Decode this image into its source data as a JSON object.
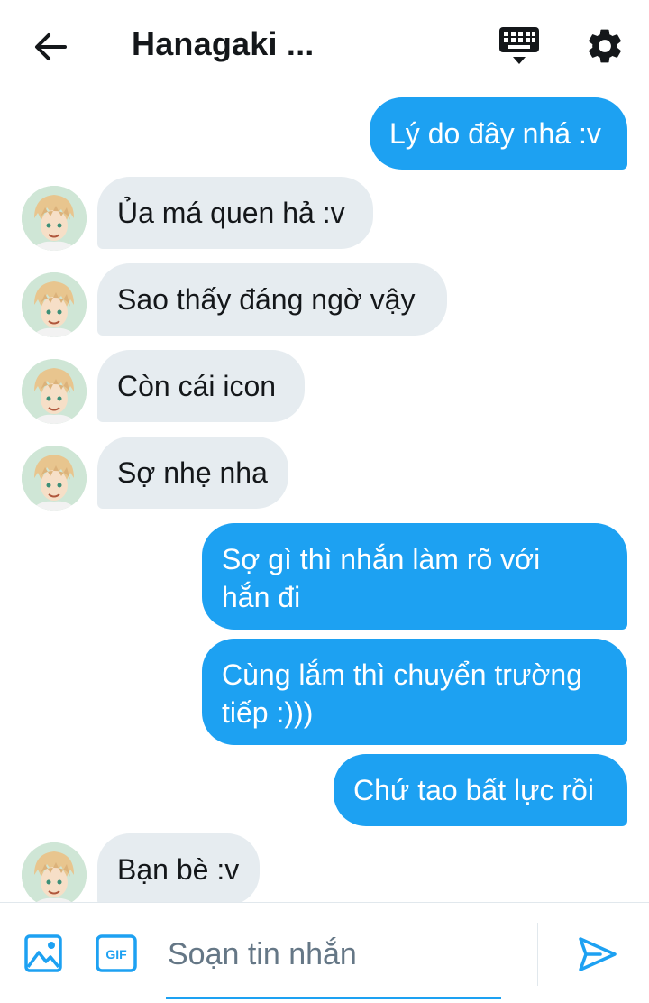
{
  "header": {
    "title": "Hanagaki ...",
    "back_icon": "arrow-left-icon",
    "keyboard_icon": "keyboard-icon",
    "settings_icon": "gear-icon"
  },
  "messages": [
    {
      "direction": "out",
      "text": "Lý do đây nhá :v"
    },
    {
      "direction": "in",
      "text": "Ủa má quen hả :v"
    },
    {
      "direction": "in",
      "text": "Sao thấy đáng ngờ vậy"
    },
    {
      "direction": "in",
      "text": "Còn cái icon"
    },
    {
      "direction": "in",
      "text": "Sợ nhẹ nha"
    },
    {
      "direction": "out",
      "text": "Sợ gì thì nhắn làm rõ với\nhắn đi"
    },
    {
      "direction": "out",
      "text": "Cùng lắm thì chuyển trường\ntiếp :)))"
    },
    {
      "direction": "out",
      "text": "Chứ tao bất lực rồi"
    },
    {
      "direction": "in",
      "text": "Bạn bè :v"
    }
  ],
  "composer": {
    "placeholder": "Soạn tin nhắn",
    "image_icon": "image-icon",
    "gif_icon": "gif-icon",
    "gif_label": "GIF",
    "send_icon": "send-icon"
  },
  "colors": {
    "accent": "#1da1f2",
    "incoming_bubble": "#e6ecf0",
    "text": "#14171a",
    "placeholder": "#657786"
  }
}
